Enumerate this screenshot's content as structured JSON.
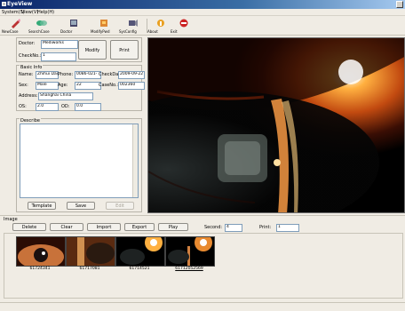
{
  "window": {
    "title": "EyeView"
  },
  "menu": [
    "System(S)",
    "View(V)",
    "Help(H)"
  ],
  "toolbar": [
    {
      "label": "NewCase",
      "icon": "new-case-icon"
    },
    {
      "label": "SearchCase",
      "icon": "search-case-icon"
    },
    {
      "label": "Doctor",
      "icon": "doctor-icon"
    },
    {
      "label": "ModifyPwd",
      "icon": "modify-password-icon"
    },
    {
      "label": "SysConfig",
      "icon": "system-config-icon"
    },
    {
      "label": "About",
      "icon": "about-icon"
    },
    {
      "label": "Exit",
      "icon": "exit-icon"
    }
  ],
  "doctor": {
    "doctor_label": "Doctor:",
    "doctor_value": "Mediworks",
    "checkno_label": "CheckNo.:",
    "checkno_value": "1",
    "modify_label": "Modify",
    "print_label": "Print"
  },
  "basic_info": {
    "title": "Basic Info",
    "name_label": "Name:",
    "name_value": "Zhihui Dai",
    "phone_label": "Phone:",
    "phone_value": "0086-021-",
    "checkdate_label": "CheckDate",
    "checkdate_value": "2009-09-22",
    "sex_label": "Sex:",
    "sex_value": "Male",
    "age_label": "Age:",
    "age_value": "22",
    "caseno_label": "CaseNo.:",
    "caseno_value": "002360",
    "address_label": "Address:",
    "address_value": "Shanghai China",
    "os_label": "OS:",
    "os_value": "2.0",
    "od_label": "OD:",
    "od_value": "0.0"
  },
  "describe": {
    "title": "Describe",
    "text": "",
    "template_label": "Template",
    "save_label": "Save",
    "edit_label": "Edit"
  },
  "image": {
    "title": "Image",
    "delete_label": "Delete",
    "clear_label": "Clear",
    "import_label": "Import",
    "export_label": "Export",
    "play_label": "Play",
    "second_label": "Second:",
    "second_value": "4",
    "print_label": "Print:",
    "print_value": "1"
  },
  "thumbnails": [
    {
      "caption": "61724341"
    },
    {
      "caption": "61717081"
    },
    {
      "caption": "61714521"
    },
    {
      "caption": "61712052569"
    }
  ]
}
